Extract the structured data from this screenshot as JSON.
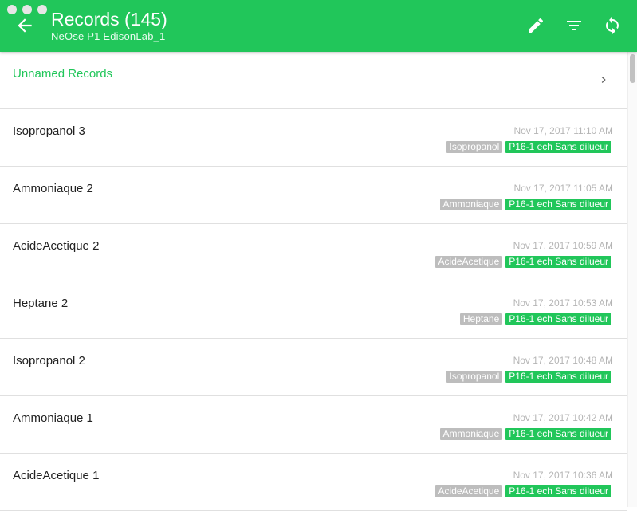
{
  "header": {
    "title": "Records (145)",
    "subtitle": "NeOse P1 EdisonLab_1",
    "background_color": "#21c65a",
    "icons": [
      "arrow-back-icon",
      "pencil-icon",
      "filter-icon",
      "sync-icon"
    ]
  },
  "unnamed": {
    "label": "Unnamed Records"
  },
  "records": [
    {
      "name": "Isopropanol 3",
      "time": "Nov 17, 2017 11:10 AM",
      "tag1": "Isopropanol",
      "tag2": "P16-1 ech Sans dilueur"
    },
    {
      "name": "Ammoniaque 2",
      "time": "Nov 17, 2017 11:05 AM",
      "tag1": "Ammoniaque",
      "tag2": "P16-1 ech Sans dilueur"
    },
    {
      "name": "AcideAcetique 2",
      "time": "Nov 17, 2017 10:59 AM",
      "tag1": "AcideAcetique",
      "tag2": "P16-1 ech Sans dilueur"
    },
    {
      "name": "Heptane 2",
      "time": "Nov 17, 2017 10:53 AM",
      "tag1": "Heptane",
      "tag2": "P16-1 ech Sans dilueur"
    },
    {
      "name": "Isopropanol 2",
      "time": "Nov 17, 2017 10:48 AM",
      "tag1": "Isopropanol",
      "tag2": "P16-1 ech Sans dilueur"
    },
    {
      "name": "Ammoniaque 1",
      "time": "Nov 17, 2017 10:42 AM",
      "tag1": "Ammoniaque",
      "tag2": "P16-1 ech Sans dilueur"
    },
    {
      "name": "AcideAcetique 1",
      "time": "Nov 17, 2017 10:36 AM",
      "tag1": "AcideAcetique",
      "tag2": "P16-1 ech Sans dilueur"
    }
  ]
}
